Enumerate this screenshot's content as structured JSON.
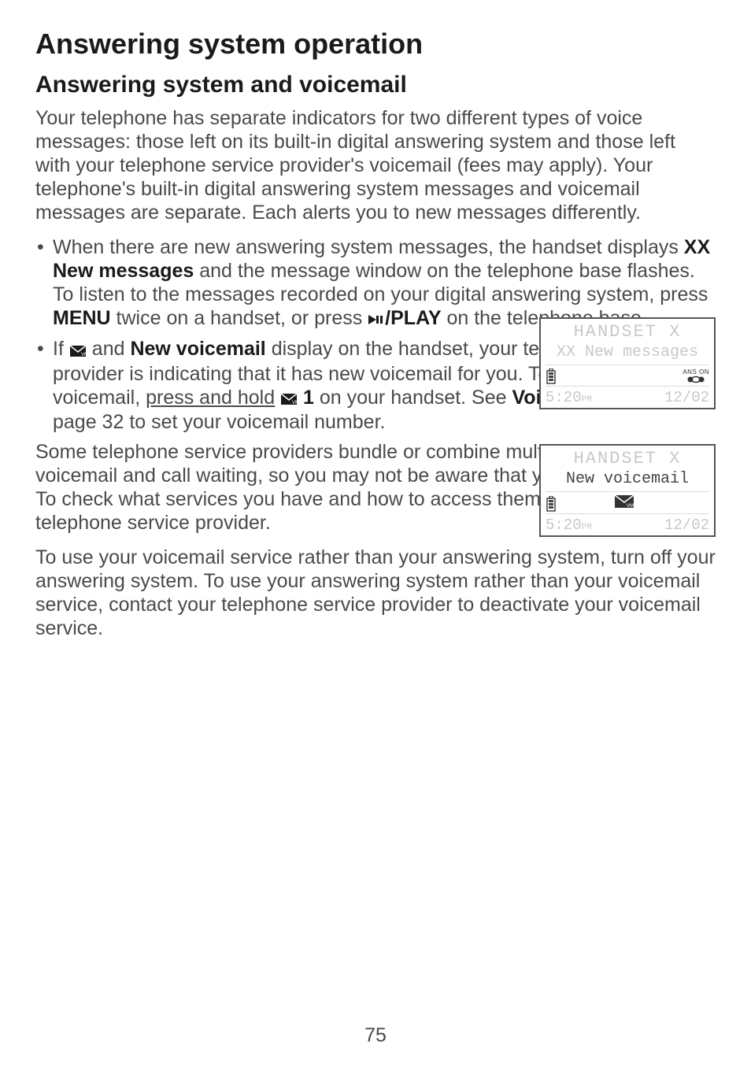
{
  "h1": "Answering system operation",
  "h2": "Answering system and voicemail",
  "p1": "Your telephone has separate indicators for two different types of voice messages: those left on its built-in digital answering system and those left with your telephone service provider's voicemail (fees may apply). Your telephone's built-in digital answering system messages and voicemail messages are separate. Each alerts you to new messages differently.",
  "b1_a": "When there are new answering system messages, the handset displays ",
  "b1_bold1": "XX New messages",
  "b1_b": " and the message window on the telephone base flashes. To listen to the messages recorded on your digital answering system, press ",
  "b1_bold2": "MENU",
  "b1_c": " twice on a handset, or press ",
  "b1_bold3": "/PLAY",
  "b1_d": " on the telephone base.",
  "b2_a": "If ",
  "b2_b": " and ",
  "b2_bold1": "New voicemail",
  "b2_c": " display on the handset, your telephone service provider is indicating that it has new voicemail for you. To listen to your voicemail, ",
  "b2_under": "press and hold",
  "b2_d": " ",
  "b2_bold2": " 1",
  "b2_e": " on your handset. See ",
  "b2_bold3": "Voicemail number",
  "b2_f": " on page 32 to set your voicemail number.",
  "p2": "Some telephone service providers bundle or combine multiple services like voicemail and call waiting, so you may not be aware that you have voicemail. To check what services you have and how to access them, contact your telephone service provider.",
  "p3": "To use your voicemail service rather than your answering system, turn off your answering system. To use your answering system rather than your voicemail service, contact your telephone service provider to deactivate your voicemail service.",
  "page": "75",
  "lcd1": {
    "row1": "HANDSET  X",
    "row2": "XX New messages",
    "ans": "ANS ON",
    "time": "5:20",
    "pm": "PM",
    "date": "12/02"
  },
  "lcd2": {
    "row1": "HANDSET  X",
    "row2": "New voicemail",
    "time": "5:20",
    "pm": "PM",
    "date": "12/02"
  }
}
